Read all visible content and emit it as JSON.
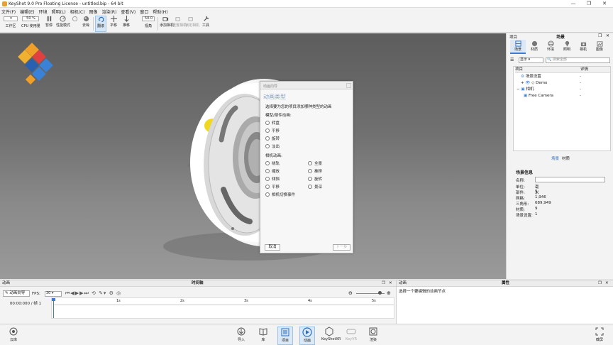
{
  "window": {
    "title": "KeyShot 9.0 Pro Floating License  - untitled.bip  - 64 bit",
    "minimize": "—",
    "maximize": "❐",
    "close": "✕"
  },
  "menu": [
    "文件(F)",
    "编辑(E)",
    "环境",
    "照明(L)",
    "相机(C)",
    "图像",
    "渲染(R)",
    "查看(V)",
    "窗口",
    "帮助(H)"
  ],
  "toolbar": {
    "workspace": "工作区",
    "cpu_value": "50 %",
    "cpu_label": "CPU 使用量",
    "pause": "暂停",
    "perf_mode": "性能模式",
    "denoise": "去噪",
    "tumble": "翻滚",
    "pan": "平移",
    "dolly": "推移",
    "fov_value": "50.0",
    "fov_label": "视角",
    "add_camera": "添加相机",
    "reset_camera": "重置相机",
    "lock_camera": "锁定相机",
    "tools": "工具"
  },
  "dialog": {
    "title": "动画向导",
    "heading": "动画类型",
    "description": "选择要为您的项目添加哪种类型的动画",
    "model_section": "模型/部件动画:",
    "model_options": [
      "转盘",
      "平移",
      "旋转",
      "淡出"
    ],
    "camera_section": "相机动画:",
    "camera_options_left": [
      "绕轨",
      "缩放",
      "倾斜",
      "平移",
      "相机切换事件"
    ],
    "camera_options_right": [
      "全景",
      "推移",
      "旋转",
      "景深"
    ],
    "cancel": "取消",
    "next": "下一步"
  },
  "right_panel": {
    "header_left": "项目",
    "header_center": "场景",
    "tabs": [
      "场景",
      "材质",
      "环境",
      "照明",
      "相机",
      "图像"
    ],
    "display_select": "显示",
    "search_placeholder": "搜索全部",
    "columns": [
      "项目",
      "详情"
    ],
    "tree": [
      {
        "label": "场景设置",
        "detail": "-"
      },
      {
        "label": "Demo",
        "detail": "-"
      },
      {
        "label": "相机",
        "detail": "-"
      },
      {
        "label": "Free Camera",
        "detail": "-"
      }
    ],
    "subtabs": [
      "场景",
      "材质"
    ],
    "info_title": "场景信息",
    "info": [
      {
        "k": "名称:",
        "v": ""
      },
      {
        "k": "单位:",
        "v": "毫米"
      },
      {
        "k": "部件:",
        "v": "9"
      },
      {
        "k": "网格:",
        "v": "1,946"
      },
      {
        "k": "三角形:",
        "v": "689,949"
      },
      {
        "k": "材质:",
        "v": "9"
      },
      {
        "k": "场景设置:",
        "v": "1"
      }
    ]
  },
  "animation_panel": {
    "title": "动画",
    "center_title": "时间轴",
    "wizard_button": "动画向导",
    "fps_label": "FPS:",
    "fps_value": "30",
    "timecode": "00:00:000 / 帧 1",
    "ticks": [
      "1s",
      "2s",
      "3s",
      "4s",
      "5s"
    ]
  },
  "properties_panel": {
    "left_title": "动画",
    "title": "属性",
    "message": "选择一个要编辑的动画节点"
  },
  "dock": {
    "cloud": "云库",
    "import": "导入",
    "library": "库",
    "project": "项目",
    "animation": "动画",
    "keyshotxr": "KeyShotXR",
    "keyvr": "KeyVR",
    "render": "渲染",
    "screenshot": "截屏"
  },
  "colors": {
    "accent": "#3a7bd5",
    "logo_orange": "#f0a028",
    "logo_blue": "#3a82d8",
    "logo_red": "#e04040"
  }
}
